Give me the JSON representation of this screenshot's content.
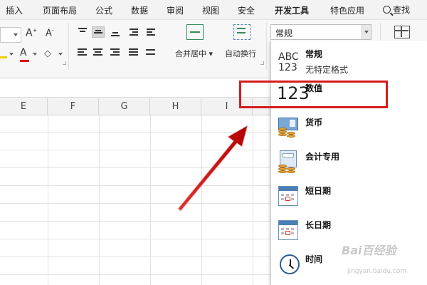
{
  "menu": {
    "items": [
      "插入",
      "页面布局",
      "公式",
      "数据",
      "审阅",
      "视图",
      "安全",
      "开发工具",
      "特色应用"
    ],
    "search": "查找"
  },
  "ribbon": {
    "grow_font": "A",
    "shrink_font": "A",
    "font_color": "A",
    "merge_label": "合并居中",
    "wrap_label": "自动换行",
    "number_format_value": "常规"
  },
  "columns": [
    "E",
    "F",
    "G",
    "H",
    "I"
  ],
  "format_options": [
    {
      "name": "常规",
      "icon": "abc-123-icon",
      "desc": "无特定格式",
      "icon_text_top": "ABC",
      "icon_text_bottom": "123"
    },
    {
      "name": "数值",
      "icon": "number-123-icon",
      "desc": "",
      "icon_text": "123"
    },
    {
      "name": "货币",
      "icon": "currency-icon",
      "desc": ""
    },
    {
      "name": "会计专用",
      "icon": "accounting-icon",
      "desc": ""
    },
    {
      "name": "短日期",
      "icon": "calendar-short-icon",
      "desc": ""
    },
    {
      "name": "长日期",
      "icon": "calendar-long-icon",
      "desc": ""
    },
    {
      "name": "时间",
      "icon": "clock-icon",
      "desc": ""
    }
  ],
  "annotation": {
    "highlight_color": "#d51c1c",
    "arrow_color": "#d51c1c"
  },
  "watermark": {
    "text": "Bai百经验",
    "url": "jingyan.baidu.com"
  }
}
